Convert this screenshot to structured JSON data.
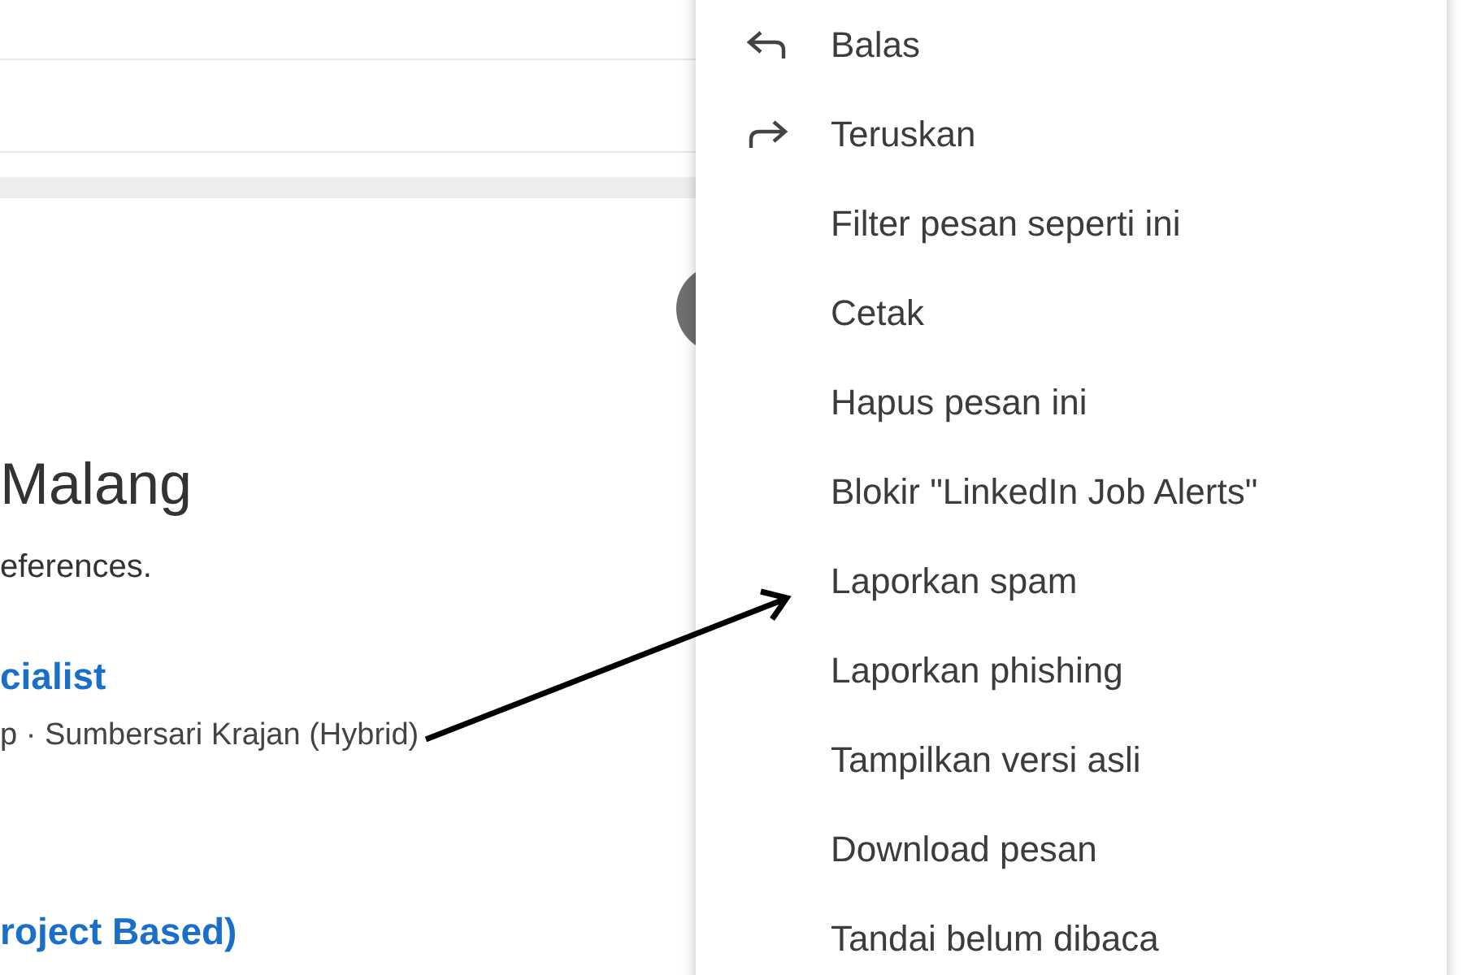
{
  "message": {
    "heading": "Malang",
    "intro": "eferences.",
    "jobs": [
      {
        "title": "cialist",
        "details": "p · Sumbersari Krajan (Hybrid)"
      },
      {
        "title": "roject Based)"
      }
    ]
  },
  "menu": {
    "items": [
      {
        "label": "Balas",
        "kind": "reply"
      },
      {
        "label": "Teruskan",
        "kind": "forward"
      },
      {
        "label": "Filter pesan seperti ini",
        "kind": "plain"
      },
      {
        "label": "Cetak",
        "kind": "plain"
      },
      {
        "label": "Hapus pesan ini",
        "kind": "plain"
      },
      {
        "label": "Blokir \"LinkedIn Job Alerts\"",
        "kind": "plain"
      },
      {
        "label": "Laporkan spam",
        "kind": "plain"
      },
      {
        "label": "Laporkan phishing",
        "kind": "plain"
      },
      {
        "label": "Tampilkan versi asli",
        "kind": "plain"
      },
      {
        "label": "Download pesan",
        "kind": "plain"
      },
      {
        "label": "Tandai belum dibaca",
        "kind": "plain"
      }
    ]
  }
}
